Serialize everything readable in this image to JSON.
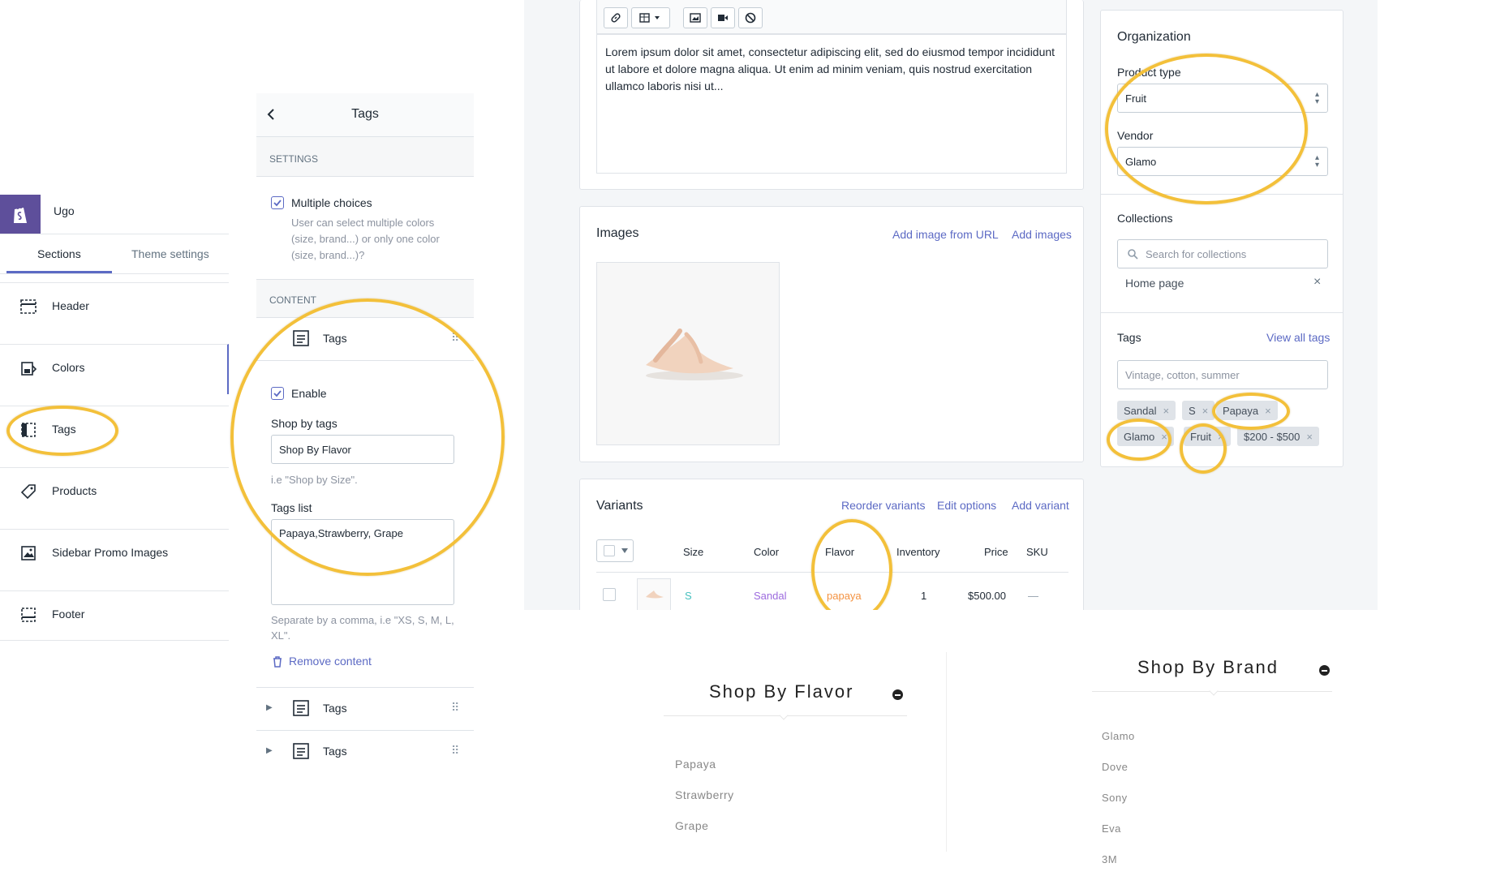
{
  "sidebar": {
    "store_name": "Ugo",
    "tabs": [
      "Sections",
      "Theme settings"
    ],
    "items": [
      {
        "label": "Header",
        "icon": "header-layout-icon"
      },
      {
        "label": "Colors",
        "icon": "paint-bucket-icon"
      },
      {
        "label": "Tags",
        "icon": "sidebar-layout-icon"
      },
      {
        "label": "Products",
        "icon": "tag-icon"
      },
      {
        "label": "Sidebar Promo Images",
        "icon": "image-icon"
      },
      {
        "label": "Footer",
        "icon": "footer-layout-icon"
      }
    ]
  },
  "tags_panel": {
    "title": "Tags",
    "settings_heading": "SETTINGS",
    "multiple_choices_label": "Multiple choices",
    "multiple_choices_help": "User can select multiple colors (size, brand...) or only one color (size, brand...)?",
    "content_heading": "CONTENT",
    "block_label": "Tags",
    "enable_label": "Enable",
    "shop_by_tags_label": "Shop by tags",
    "shop_by_tags_value": "Shop By Flavor",
    "shop_by_tags_help": "i.e \"Shop by Size\".",
    "tags_list_label": "Tags list",
    "tags_list_value": "Papaya,Strawberry, Grape",
    "tags_list_help": "Separate by a comma, i.e \"XS, S, M, L, XL\".",
    "remove_content": "Remove content",
    "collapsed_blocks": [
      "Tags",
      "Tags"
    ]
  },
  "description": {
    "text": "Lorem ipsum dolor sit amet, consectetur adipiscing elit, sed do eiusmod tempor incididunt ut labore et dolore magna aliqua. Ut enim ad minim veniam, quis nostrud exercitation ullamco laboris nisi ut..."
  },
  "images": {
    "title": "Images",
    "add_from_url": "Add image from URL",
    "add_images": "Add images"
  },
  "variants": {
    "title": "Variants",
    "reorder": "Reorder variants",
    "edit_options": "Edit options",
    "add_variant": "Add variant",
    "columns": [
      "Size",
      "Color",
      "Flavor",
      "Inventory",
      "Price",
      "SKU"
    ],
    "rows": [
      {
        "size": "S",
        "color": "Sandal",
        "flavor": "papaya",
        "inventory": "1",
        "price": "$500.00",
        "sku": "—"
      }
    ]
  },
  "organization": {
    "title": "Organization",
    "product_type_label": "Product type",
    "product_type_value": "Fruit",
    "vendor_label": "Vendor",
    "vendor_value": "Glamo",
    "collections_label": "Collections",
    "collections_placeholder": "Search for collections",
    "collections_selected": "Home page",
    "tags_label": "Tags",
    "view_all_tags": "View all tags",
    "tags_placeholder": "Vintage, cotton, summer",
    "tags": [
      "Sandal",
      "S",
      "Papaya",
      "Glamo",
      "Fruit",
      "$200 - $500"
    ]
  },
  "storefront": {
    "flavor_title": "Shop By Flavor",
    "flavors": [
      "Papaya",
      "Strawberry",
      "Grape"
    ],
    "brand_title": "Shop By Brand",
    "brands": [
      "Glamo",
      "Dove",
      "Sony",
      "Eva",
      "3M"
    ]
  },
  "colors": {
    "accent": "#5c6ac4",
    "highlight": "#f3c03a",
    "brand": "#5e4f9b",
    "teal": "#47c1bf",
    "orange": "#f49342"
  }
}
